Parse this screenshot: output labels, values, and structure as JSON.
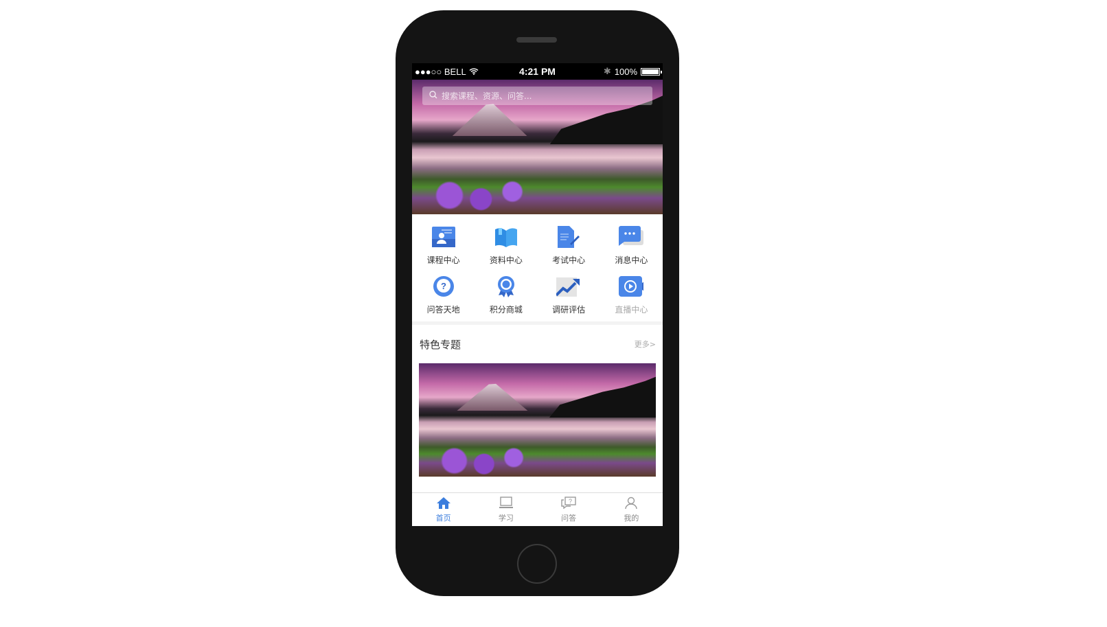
{
  "status_bar": {
    "carrier": "●●●○○ BELL",
    "time": "4:21 PM",
    "battery": "100%",
    "battery_level": 1.0
  },
  "search": {
    "placeholder": "搜索课程、资源、问答..."
  },
  "grid": [
    {
      "label": "课程中心",
      "icon": "course-icon"
    },
    {
      "label": "资料中心",
      "icon": "book-icon"
    },
    {
      "label": "考试中心",
      "icon": "exam-icon"
    },
    {
      "label": "消息中心",
      "icon": "message-icon"
    },
    {
      "label": "问答天地",
      "icon": "question-icon"
    },
    {
      "label": "积分商城",
      "icon": "medal-icon"
    },
    {
      "label": "调研评估",
      "icon": "trend-icon"
    },
    {
      "label": "直播中心",
      "icon": "video-icon"
    }
  ],
  "section": {
    "title": "特色专题",
    "more": "更多>"
  },
  "tabs": [
    {
      "label": "首页",
      "icon": "home-icon"
    },
    {
      "label": "学习",
      "icon": "laptop-icon"
    },
    {
      "label": "问答",
      "icon": "qa-icon"
    },
    {
      "label": "我的",
      "icon": "user-icon"
    }
  ],
  "colors": {
    "accent": "#3b7ddd"
  }
}
